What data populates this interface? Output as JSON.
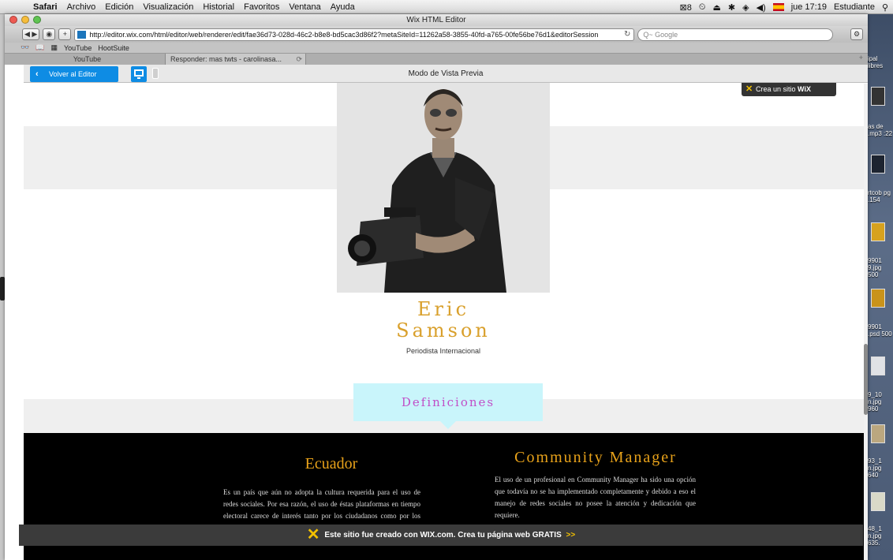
{
  "menubar": {
    "app": "Safari",
    "items": [
      "Archivo",
      "Edición",
      "Visualización",
      "Historial",
      "Favoritos",
      "Ventana",
      "Ayuda"
    ],
    "status": {
      "input_indicator": "8",
      "clock": "jue 17:19",
      "user": "Estudiante"
    }
  },
  "window": {
    "title": "Wix HTML Editor",
    "url": "http://editor.wix.com/html/editor/web/renderer/edit/fae36d73-028d-46c2-b8e8-bd5cac3d86f2?metaSiteId=11262a58-3855-40fd-a765-00fe56be76d1&editorSession",
    "search_placeholder": "Q~ Google"
  },
  "bookmarks": [
    "YouTube",
    "HootSuite"
  ],
  "tabs": [
    {
      "label": "YouTube"
    },
    {
      "label": "Responder: mas twts - carolinasa..."
    }
  ],
  "preview_bar": {
    "back_label": "Volver al Editor",
    "title": "Modo de Vista Previa"
  },
  "page": {
    "badge": {
      "prefix": "Crea un sitio",
      "brand": "WiX"
    },
    "name_line1": "Eric",
    "name_line2": "Samson",
    "role": "Periodista Internacional",
    "definitions_heading": "Definiciones",
    "columns": [
      {
        "title": "Ecuador",
        "text": "Es un país que aún no adopta la cultura requerida para el uso de redes sociales. Por esa razón, el uso de éstas plataformas en tiempo electoral carece de interés tanto por los ciudadanos como por los representantes políticos."
      },
      {
        "title": "Community Manager",
        "text": "El uso de un profesional en Community Manager ha sido una opción que todavía no se ha implementado completamente y debido a eso el manejo de redes sociales no posee la atención y dedicación que requiere."
      }
    ],
    "footer": {
      "text": "Este sitio fue creado con WIX.com. Crea tu página web GRATIS",
      "arrow": ">>"
    }
  },
  "desktop_items": [
    {
      "label": "ipal libres"
    },
    {
      "label": "as de .mp3 :22"
    },
    {
      "label": "rtcob pg .154"
    },
    {
      "label": "9901 9.jpg 500"
    },
    {
      "label": "9901 .psd 500"
    },
    {
      "label": "9_10 n.jpg 960"
    },
    {
      "label": "93_1 n.jpg 640"
    },
    {
      "label": "48_1 n.jpg 635."
    }
  ],
  "colors": {
    "accent_blue": "#0e8ce4",
    "gold": "#d9a02c",
    "definition_bg": "#c9f5fb",
    "definition_text": "#c14fc7",
    "wix_yellow": "#f3c100"
  }
}
